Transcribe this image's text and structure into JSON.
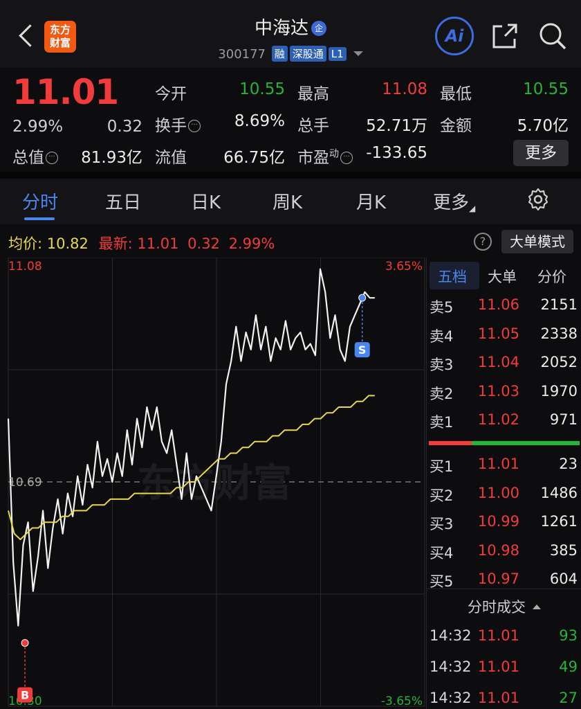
{
  "header": {
    "logo_line1": "东方",
    "logo_line2": "财富",
    "title": "中海达",
    "title_badge": "企",
    "code": "300177",
    "tags": [
      "融",
      "深股通",
      "L1"
    ],
    "ai_label": "Ai"
  },
  "quote": {
    "price": "11.01",
    "change_pct": "2.99%",
    "change": "0.32",
    "market_cap_label": "总值",
    "market_cap": "81.93亿",
    "open_label": "今开",
    "open": "10.55",
    "high_label": "最高",
    "high": "11.08",
    "low_label": "最低",
    "low": "10.55",
    "turnover_label": "换手",
    "turnover": "8.69%",
    "volume_label": "总手",
    "volume": "52.71万",
    "amount_label": "金额",
    "amount": "5.70亿",
    "float_cap_label": "流值",
    "float_cap": "66.75亿",
    "pe_label": "市盈",
    "pe_sup": "动",
    "pe": "-133.65",
    "more_label": "更多"
  },
  "tabs": [
    "分时",
    "五日",
    "日K",
    "周K",
    "月K",
    "更多"
  ],
  "infoline": {
    "avg_label": "均价:",
    "avg": "10.82",
    "latest_label": "最新:",
    "latest": "11.01",
    "chg": "0.32",
    "pct": "2.99%",
    "bigorder_label": "大单模式",
    "help": "?"
  },
  "chart_data": {
    "type": "line",
    "y_top": "11.08",
    "y_mid": "10.69",
    "y_bottom": "10.30",
    "pct_top": "3.65%",
    "pct_bottom": "-3.65%",
    "ylim": [
      10.3,
      11.08
    ],
    "watermark": "东方财富",
    "markers": [
      {
        "label": "B",
        "price": 10.41,
        "t": 0.04
      },
      {
        "label": "S",
        "price": 11.01,
        "t": 0.85
      }
    ],
    "series": [
      {
        "values": [
          10.8,
          10.55,
          10.44,
          10.58,
          10.62,
          10.5,
          10.56,
          10.64,
          10.54,
          10.61,
          10.66,
          10.6,
          10.67,
          10.63,
          10.7,
          10.65,
          10.72,
          10.68,
          10.76,
          10.7,
          10.73,
          10.69,
          10.74,
          10.7,
          10.78,
          10.72,
          10.8,
          10.75,
          10.82,
          10.78,
          10.82,
          10.76,
          10.74,
          10.78,
          10.72,
          10.66,
          10.74,
          10.66,
          10.7,
          10.68,
          10.66,
          10.64,
          10.7,
          10.76,
          10.86,
          10.9,
          10.96,
          10.9,
          10.95,
          10.92,
          10.98,
          10.92,
          10.96,
          10.9,
          10.94,
          10.92,
          10.97,
          10.92,
          10.94,
          10.95,
          10.92,
          10.93,
          10.91,
          11.06,
          11.02,
          10.94,
          10.98,
          10.92,
          10.9,
          10.96,
          10.98,
          11.0,
          11.02,
          11.01,
          11.01
        ]
      },
      {
        "values": [
          10.64,
          10.6,
          10.59,
          10.6,
          10.61,
          10.61,
          10.62,
          10.62,
          10.62,
          10.63,
          10.63,
          10.64,
          10.64,
          10.64,
          10.65,
          10.65,
          10.65,
          10.66,
          10.66,
          10.66,
          10.66,
          10.67,
          10.67,
          10.67,
          10.67,
          10.67,
          10.67,
          10.67,
          10.68,
          10.68,
          10.69,
          10.69,
          10.7,
          10.71,
          10.72,
          10.73,
          10.73,
          10.74,
          10.74,
          10.75,
          10.75,
          10.76,
          10.76,
          10.76,
          10.77,
          10.77,
          10.78,
          10.78,
          10.78,
          10.79,
          10.79,
          10.8,
          10.8,
          10.81,
          10.81,
          10.82,
          10.82,
          10.82,
          10.83,
          10.83,
          10.84,
          10.84
        ]
      }
    ]
  },
  "orderbook": {
    "tabs": [
      "五档",
      "大单",
      "分价"
    ],
    "asks": [
      {
        "l": "卖5",
        "p": "11.06",
        "v": "2151"
      },
      {
        "l": "卖4",
        "p": "11.05",
        "v": "2338"
      },
      {
        "l": "卖3",
        "p": "11.04",
        "v": "2052"
      },
      {
        "l": "卖2",
        "p": "11.03",
        "v": "1970"
      },
      {
        "l": "卖1",
        "p": "11.02",
        "v": "971"
      }
    ],
    "bids": [
      {
        "l": "买1",
        "p": "11.01",
        "v": "23"
      },
      {
        "l": "买2",
        "p": "11.00",
        "v": "1486"
      },
      {
        "l": "买3",
        "p": "10.99",
        "v": "1261"
      },
      {
        "l": "买4",
        "p": "10.98",
        "v": "385"
      },
      {
        "l": "买5",
        "p": "10.97",
        "v": "604"
      }
    ],
    "trades_label": "分时成交",
    "trades": [
      {
        "t": "14:32",
        "p": "11.01",
        "v": "93"
      },
      {
        "t": "14:32",
        "p": "11.01",
        "v": "49"
      },
      {
        "t": "14:32",
        "p": "11.01",
        "v": "27"
      }
    ]
  },
  "colors": {
    "up": "#f23c3c",
    "down": "#25b43a",
    "accent": "#4a86f0",
    "avg_line": "#e8d84a",
    "bg": "#0d0d0f"
  }
}
